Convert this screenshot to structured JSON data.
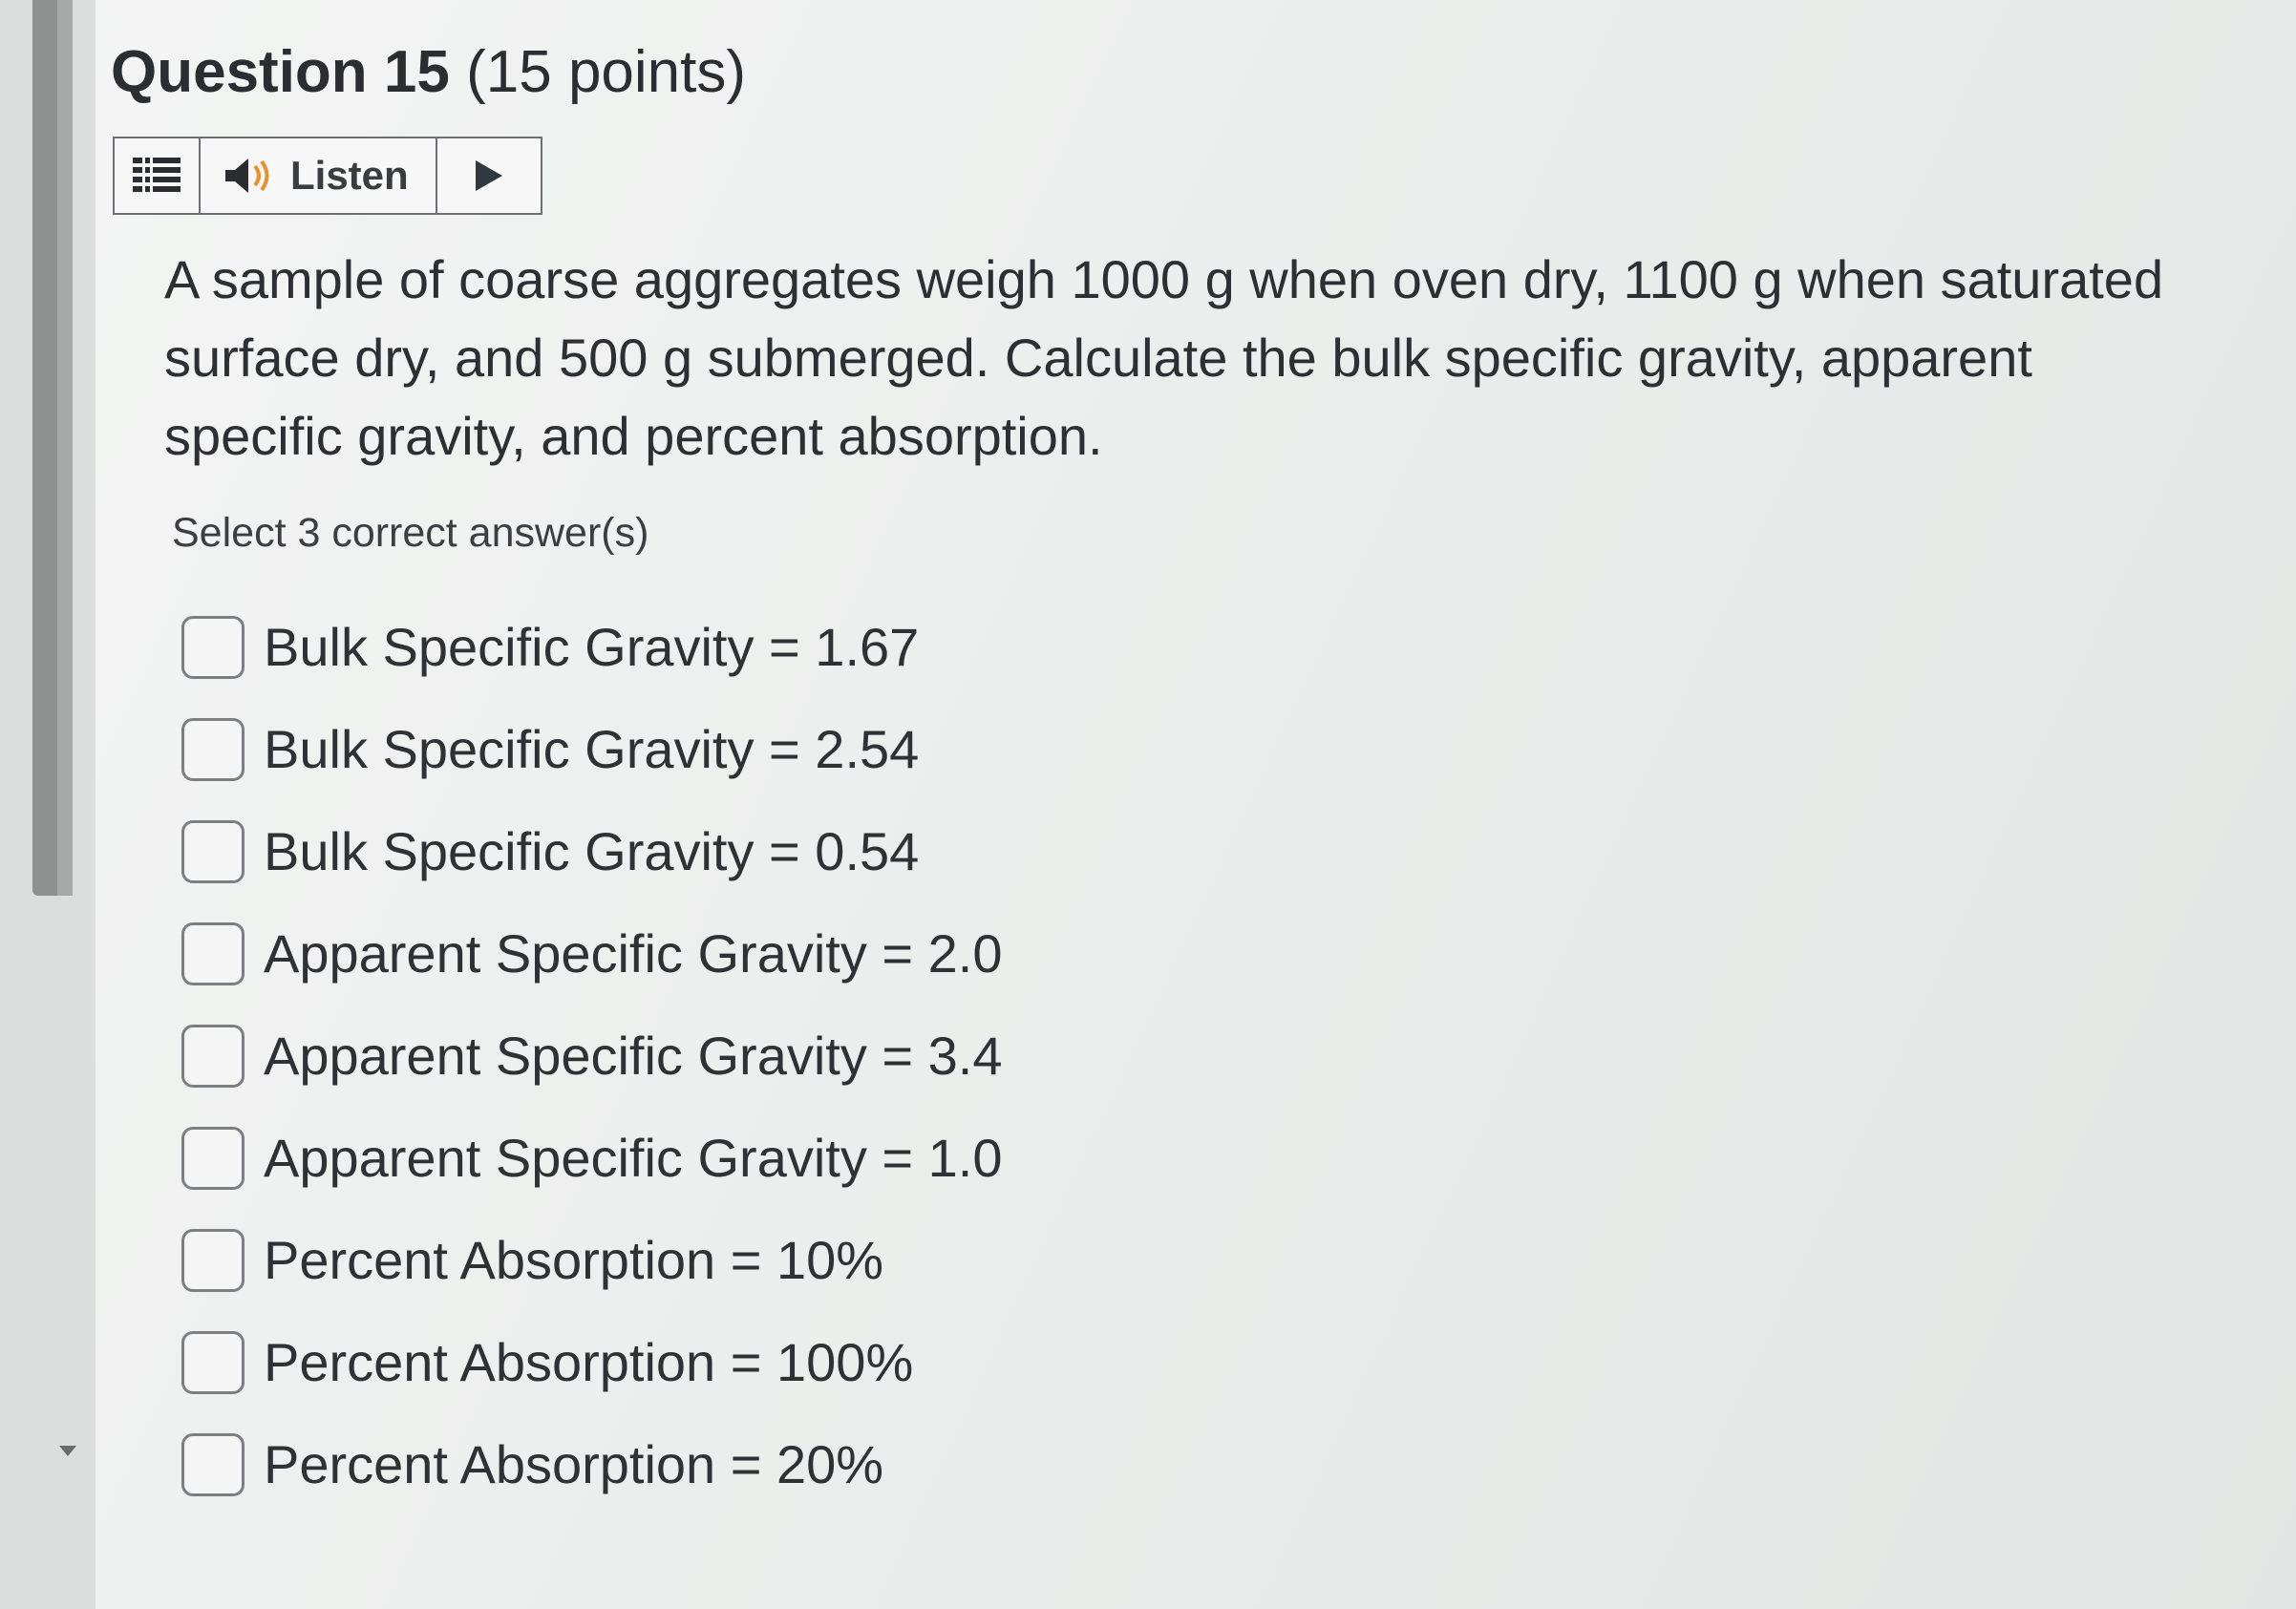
{
  "question": {
    "title": "Question 15",
    "points": "(15 points)"
  },
  "listen_bar": {
    "menu_icon": "menu-icon",
    "speaker_icon": "speaker-icon",
    "listen_label": "Listen",
    "play_icon": "play-icon"
  },
  "prompt": "A sample of coarse aggregates weigh 1000 g when oven dry, 1100 g when saturated surface dry, and 500 g submerged. Calculate the bulk specific gravity, apparent specific gravity, and percent absorption.",
  "instruction": "Select 3 correct answer(s)",
  "options": [
    {
      "label": "Bulk Specific Gravity = 1.67",
      "checked": false
    },
    {
      "label": "Bulk Specific Gravity = 2.54",
      "checked": false
    },
    {
      "label": "Bulk Specific Gravity = 0.54",
      "checked": false
    },
    {
      "label": "Apparent Specific Gravity = 2.0",
      "checked": false
    },
    {
      "label": "Apparent Specific Gravity = 3.4",
      "checked": false
    },
    {
      "label": "Apparent Specific Gravity = 1.0",
      "checked": false
    },
    {
      "label": "Percent Absorption = 10%",
      "checked": false
    },
    {
      "label": "Percent Absorption = 100%",
      "checked": false
    },
    {
      "label": "Percent Absorption = 20%",
      "checked": false
    }
  ],
  "colors": {
    "background": "#eceeed",
    "text": "#2d2f33",
    "border": "#6d6f72",
    "scrollbar_thumb": "#8f9190",
    "play_arrow": "#2e3a3e"
  }
}
